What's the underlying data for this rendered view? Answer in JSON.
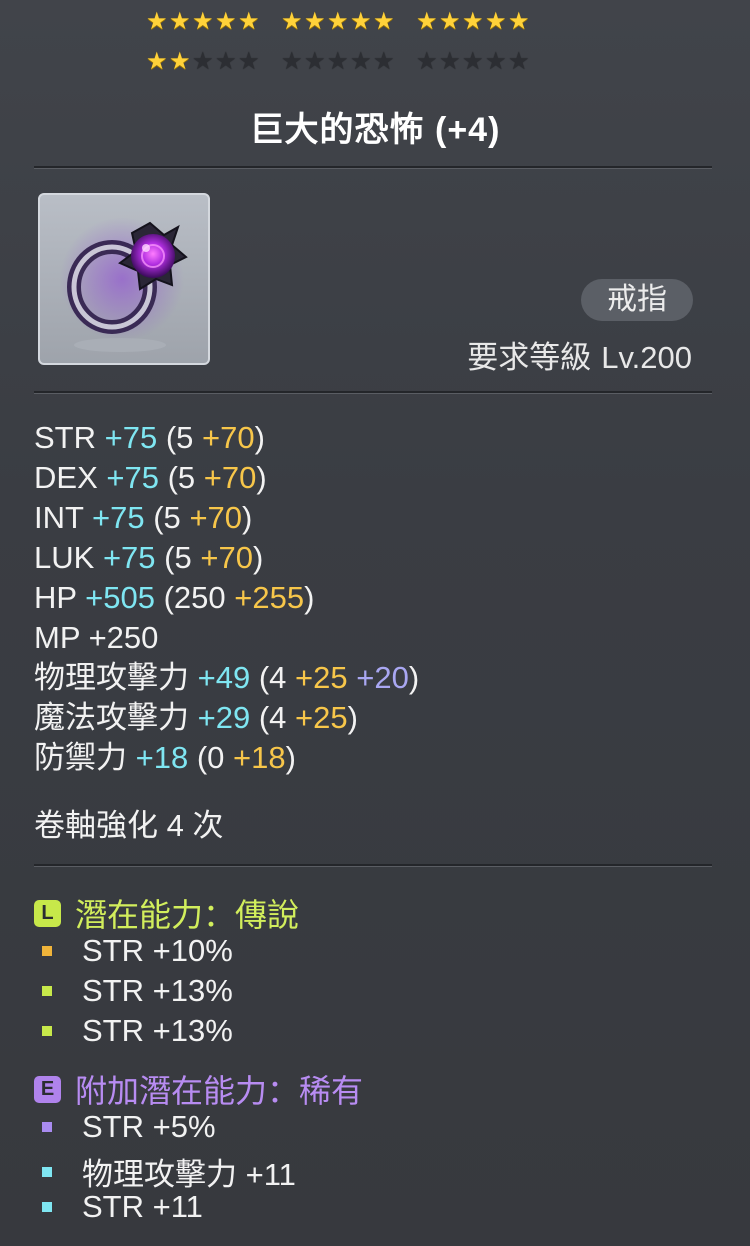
{
  "stars": {
    "row1": [
      [
        1,
        1,
        1,
        1,
        1
      ],
      [
        1,
        1,
        1,
        1,
        1
      ],
      [
        1,
        1,
        1,
        1,
        1
      ]
    ],
    "row2": [
      [
        1,
        1,
        0,
        0,
        0
      ],
      [
        0,
        0,
        0,
        0,
        0
      ],
      [
        0,
        0,
        0,
        0,
        0
      ]
    ],
    "filled_count": 17,
    "total": 30
  },
  "item": {
    "name": "巨大的恐怖 (+4)",
    "category": "戒指",
    "req_label": "要求等級",
    "req_level": "Lv.200",
    "icon": "dark-ring-icon"
  },
  "stats": [
    {
      "name": "STR",
      "total": "+75",
      "open": "(5",
      "parts": [
        {
          "v": "+70",
          "c": "yellow"
        }
      ],
      "close": ")"
    },
    {
      "name": "DEX",
      "total": "+75",
      "open": "(5",
      "parts": [
        {
          "v": "+70",
          "c": "yellow"
        }
      ],
      "close": ")"
    },
    {
      "name": "INT",
      "total": "+75",
      "open": "(5",
      "parts": [
        {
          "v": "+70",
          "c": "yellow"
        }
      ],
      "close": ")"
    },
    {
      "name": "LUK",
      "total": "+75",
      "open": "(5",
      "parts": [
        {
          "v": "+70",
          "c": "yellow"
        }
      ],
      "close": ")"
    },
    {
      "name": "HP",
      "total": "+505",
      "open": "(250",
      "parts": [
        {
          "v": "+255",
          "c": "yellow"
        }
      ],
      "close": ")"
    },
    {
      "name": "MP",
      "total": "+250",
      "plain": true
    },
    {
      "name": "物理攻擊力",
      "total": "+49",
      "open": "(4",
      "parts": [
        {
          "v": "+25",
          "c": "yellow"
        },
        {
          "v": "+20",
          "c": "purple"
        }
      ],
      "close": ")"
    },
    {
      "name": "魔法攻擊力",
      "total": "+29",
      "open": "(4",
      "parts": [
        {
          "v": "+25",
          "c": "yellow"
        }
      ],
      "close": ")"
    },
    {
      "name": "防禦力",
      "total": "+18",
      "open": "(0",
      "parts": [
        {
          "v": "+18",
          "c": "yellow"
        }
      ],
      "close": ")"
    }
  ],
  "scroll_text": "卷軸強化 4 次",
  "potential": {
    "badge": "L",
    "title": "潛在能力：傳說",
    "lines": [
      {
        "text": "STR +10%",
        "bullet": "#f0b43a"
      },
      {
        "text": "STR +13%",
        "bullet": "#c7e84a"
      },
      {
        "text": "STR +13%",
        "bullet": "#c7e84a"
      }
    ]
  },
  "additional": {
    "badge": "E",
    "title": "附加潛在能力：稀有",
    "lines": [
      {
        "text": "STR +5%",
        "bullet": "#a98bf0"
      },
      {
        "text": "物理攻擊力 +11",
        "bullet": "#7fe6f2"
      },
      {
        "text": "STR +11",
        "bullet": "#7fe6f2"
      }
    ]
  },
  "colors": {
    "cyan": "#7fe6f2",
    "yellow": "#f7c64a",
    "purple": "#a9a7f2",
    "legendary": "#d2ee5c",
    "rare": "#b88cf2"
  }
}
